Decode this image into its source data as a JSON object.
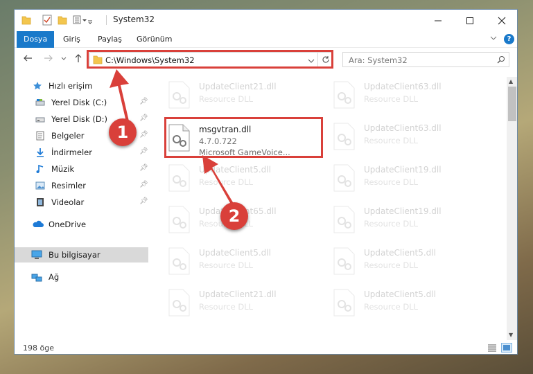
{
  "window": {
    "title": "System32",
    "quick_access_icons": [
      "folder-icon",
      "properties-check-icon",
      "new-folder-icon",
      "toolbar-customize-icon"
    ]
  },
  "ribbon": {
    "tabs": [
      {
        "label": "Dosya",
        "active": true
      },
      {
        "label": "Giriş",
        "active": false
      },
      {
        "label": "Paylaş",
        "active": false
      },
      {
        "label": "Görünüm",
        "active": false
      }
    ],
    "help_label": "?"
  },
  "address": {
    "path": "C:\\Windows\\System32",
    "search_placeholder": "Ara: System32"
  },
  "nav": {
    "quick_access": {
      "label": "Hızlı erişim",
      "icon": "star-icon"
    },
    "items": [
      {
        "label": "Yerel Disk (C:)",
        "icon": "drive-icon",
        "pinned": true
      },
      {
        "label": "Yerel Disk (D:)",
        "icon": "drive-icon",
        "pinned": true
      },
      {
        "label": "Belgeler",
        "icon": "documents-icon",
        "pinned": true
      },
      {
        "label": "İndirmeler",
        "icon": "download-icon",
        "pinned": true
      },
      {
        "label": "Müzik",
        "icon": "music-icon",
        "pinned": true
      },
      {
        "label": "Resimler",
        "icon": "pictures-icon",
        "pinned": true
      },
      {
        "label": "Videolar",
        "icon": "videos-icon",
        "pinned": true
      }
    ],
    "onedrive": {
      "label": "OneDrive",
      "icon": "cloud-icon"
    },
    "this_pc": {
      "label": "Bu bilgisayar",
      "icon": "computer-icon",
      "selected": true
    },
    "network": {
      "label": "Ağ",
      "icon": "network-icon"
    }
  },
  "files": {
    "highlighted": {
      "name": "msgvtran.dll",
      "version": "4.7.0.722",
      "description": "Microsoft GameVoice..."
    },
    "left_column": [
      {
        "name": "UpdateClient21.dll",
        "description": "Resource DLL"
      },
      null,
      {
        "name": "UpdateClient5.dll",
        "description": "Resource DLL"
      },
      {
        "name": "UpdateClient65.dll",
        "description": "Resource DLL"
      },
      {
        "name": "UpdateClient5.dll",
        "description": "Resource DLL"
      },
      {
        "name": "UpdateClient21.dll",
        "description": "Resource DLL"
      }
    ],
    "right_column": [
      {
        "name": "UpdateClient63.dll",
        "description": "Resource DLL"
      },
      {
        "name": "UpdateClient63.dll",
        "description": "Resource DLL"
      },
      {
        "name": "UpdateClient19.dll",
        "description": "Resource DLL"
      },
      {
        "name": "UpdateClient19.dll",
        "description": "Resource DLL"
      },
      {
        "name": "UpdateClient5.dll",
        "description": "Resource DLL"
      },
      {
        "name": "UpdateClient5.dll",
        "description": "Resource DLL"
      }
    ]
  },
  "status": {
    "item_count": "198 öge"
  },
  "annotations": {
    "step1": "1",
    "step2": "2",
    "color": "#d9403a"
  }
}
